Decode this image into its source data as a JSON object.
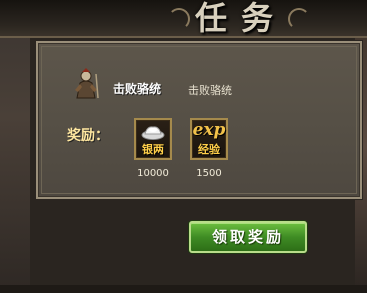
{
  "window": {
    "title": "任务"
  },
  "task": {
    "name": "击败骆统",
    "description": "击败骆统",
    "icon": "warrior-portrait-icon"
  },
  "rewards": {
    "label": "奖励：",
    "items": [
      {
        "name": "银两",
        "icon": "silver-ingot-icon",
        "amount": "10000"
      },
      {
        "name": "经验",
        "icon_text": "exp",
        "icon": "exp-icon",
        "amount": "1500"
      }
    ]
  },
  "actions": {
    "claim_label": "领取奖励"
  },
  "colors": {
    "panel": "#565046",
    "border": "#9a8f7a",
    "reward_text": "#ffcf4a",
    "button": "#3f8c24"
  }
}
